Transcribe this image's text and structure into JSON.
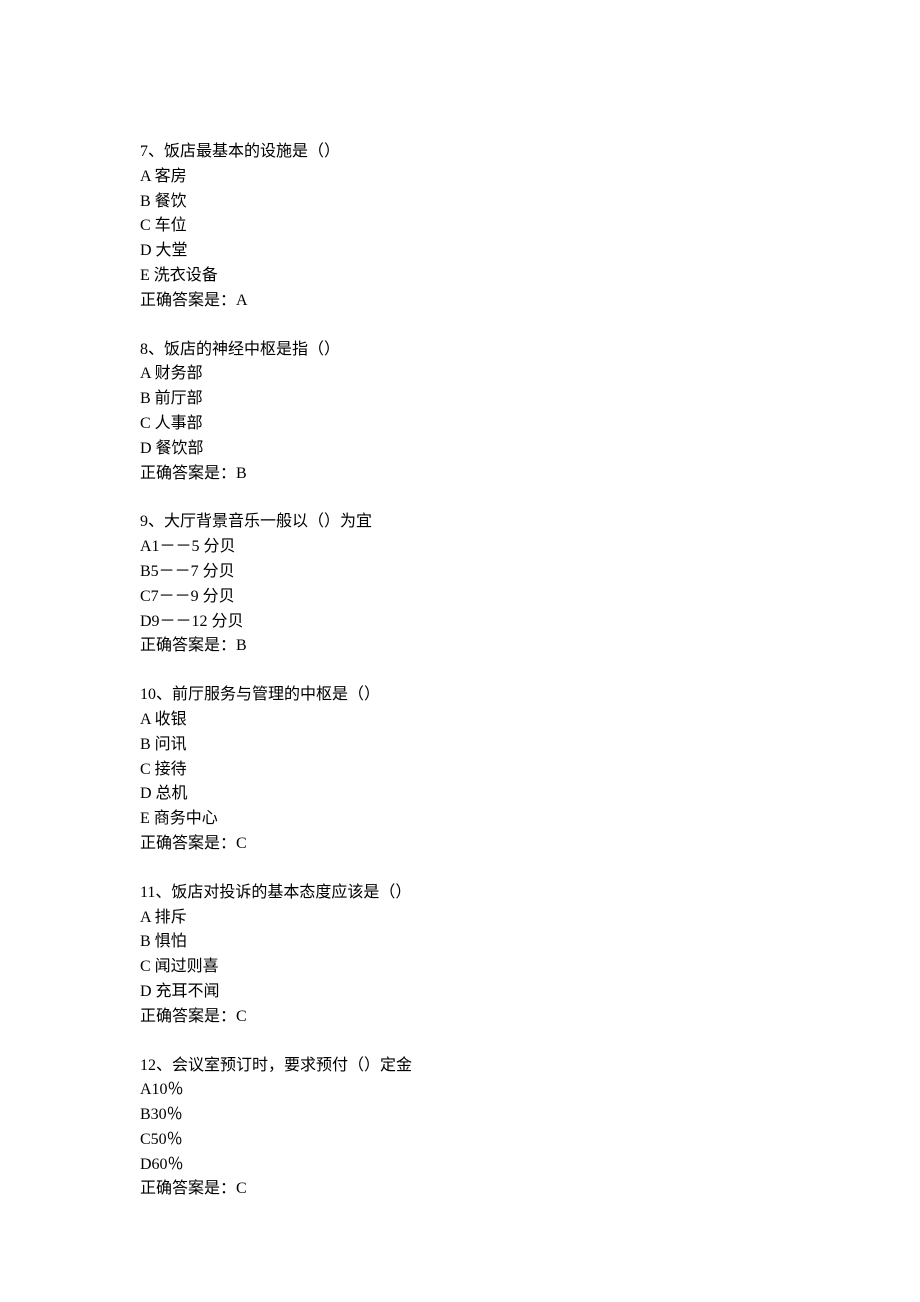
{
  "questions": [
    {
      "number": "7",
      "text": "饭店最基本的设施是（）",
      "options": [
        {
          "letter": "A",
          "text": "客房"
        },
        {
          "letter": "B",
          "text": "餐饮"
        },
        {
          "letter": "C",
          "text": "车位"
        },
        {
          "letter": "D",
          "text": "大堂"
        },
        {
          "letter": "E",
          "text": "洗衣设备"
        }
      ],
      "answer_label": "正确答案是：",
      "answer": "A"
    },
    {
      "number": "8",
      "text": "饭店的神经中枢是指（）",
      "options": [
        {
          "letter": "A",
          "text": "财务部"
        },
        {
          "letter": "B",
          "text": "前厅部"
        },
        {
          "letter": "C",
          "text": "人事部"
        },
        {
          "letter": "D",
          "text": "餐饮部"
        }
      ],
      "answer_label": "正确答案是：",
      "answer": "B"
    },
    {
      "number": "9",
      "text": "大厅背景音乐一般以（）为宜",
      "options": [
        {
          "letter": "A",
          "text": "1－－5 分贝"
        },
        {
          "letter": "B",
          "text": "5－－7 分贝"
        },
        {
          "letter": "C",
          "text": "7－－9 分贝"
        },
        {
          "letter": "D",
          "text": "9－－12 分贝"
        }
      ],
      "answer_label": "正确答案是：",
      "answer": "B"
    },
    {
      "number": "10",
      "text": "前厅服务与管理的中枢是（）",
      "options": [
        {
          "letter": "A",
          "text": "收银"
        },
        {
          "letter": "B",
          "text": "问讯"
        },
        {
          "letter": "C",
          "text": "接待"
        },
        {
          "letter": "D",
          "text": "总机"
        },
        {
          "letter": "E",
          "text": "商务中心"
        }
      ],
      "answer_label": "正确答案是：",
      "answer": "C"
    },
    {
      "number": "11",
      "text": "饭店对投诉的基本态度应该是（）",
      "options": [
        {
          "letter": "A",
          "text": "排斥"
        },
        {
          "letter": "B",
          "text": "惧怕"
        },
        {
          "letter": "C",
          "text": "闻过则喜"
        },
        {
          "letter": "D",
          "text": "充耳不闻"
        }
      ],
      "answer_label": "正确答案是：",
      "answer": "C"
    },
    {
      "number": "12",
      "text": "会议室预订时，要求预付（）定金",
      "options": [
        {
          "letter": "A",
          "text": "10％"
        },
        {
          "letter": "B",
          "text": "30％"
        },
        {
          "letter": "C",
          "text": "50％"
        },
        {
          "letter": "D",
          "text": "60％"
        }
      ],
      "answer_label": "正确答案是：",
      "answer": "C"
    }
  ]
}
